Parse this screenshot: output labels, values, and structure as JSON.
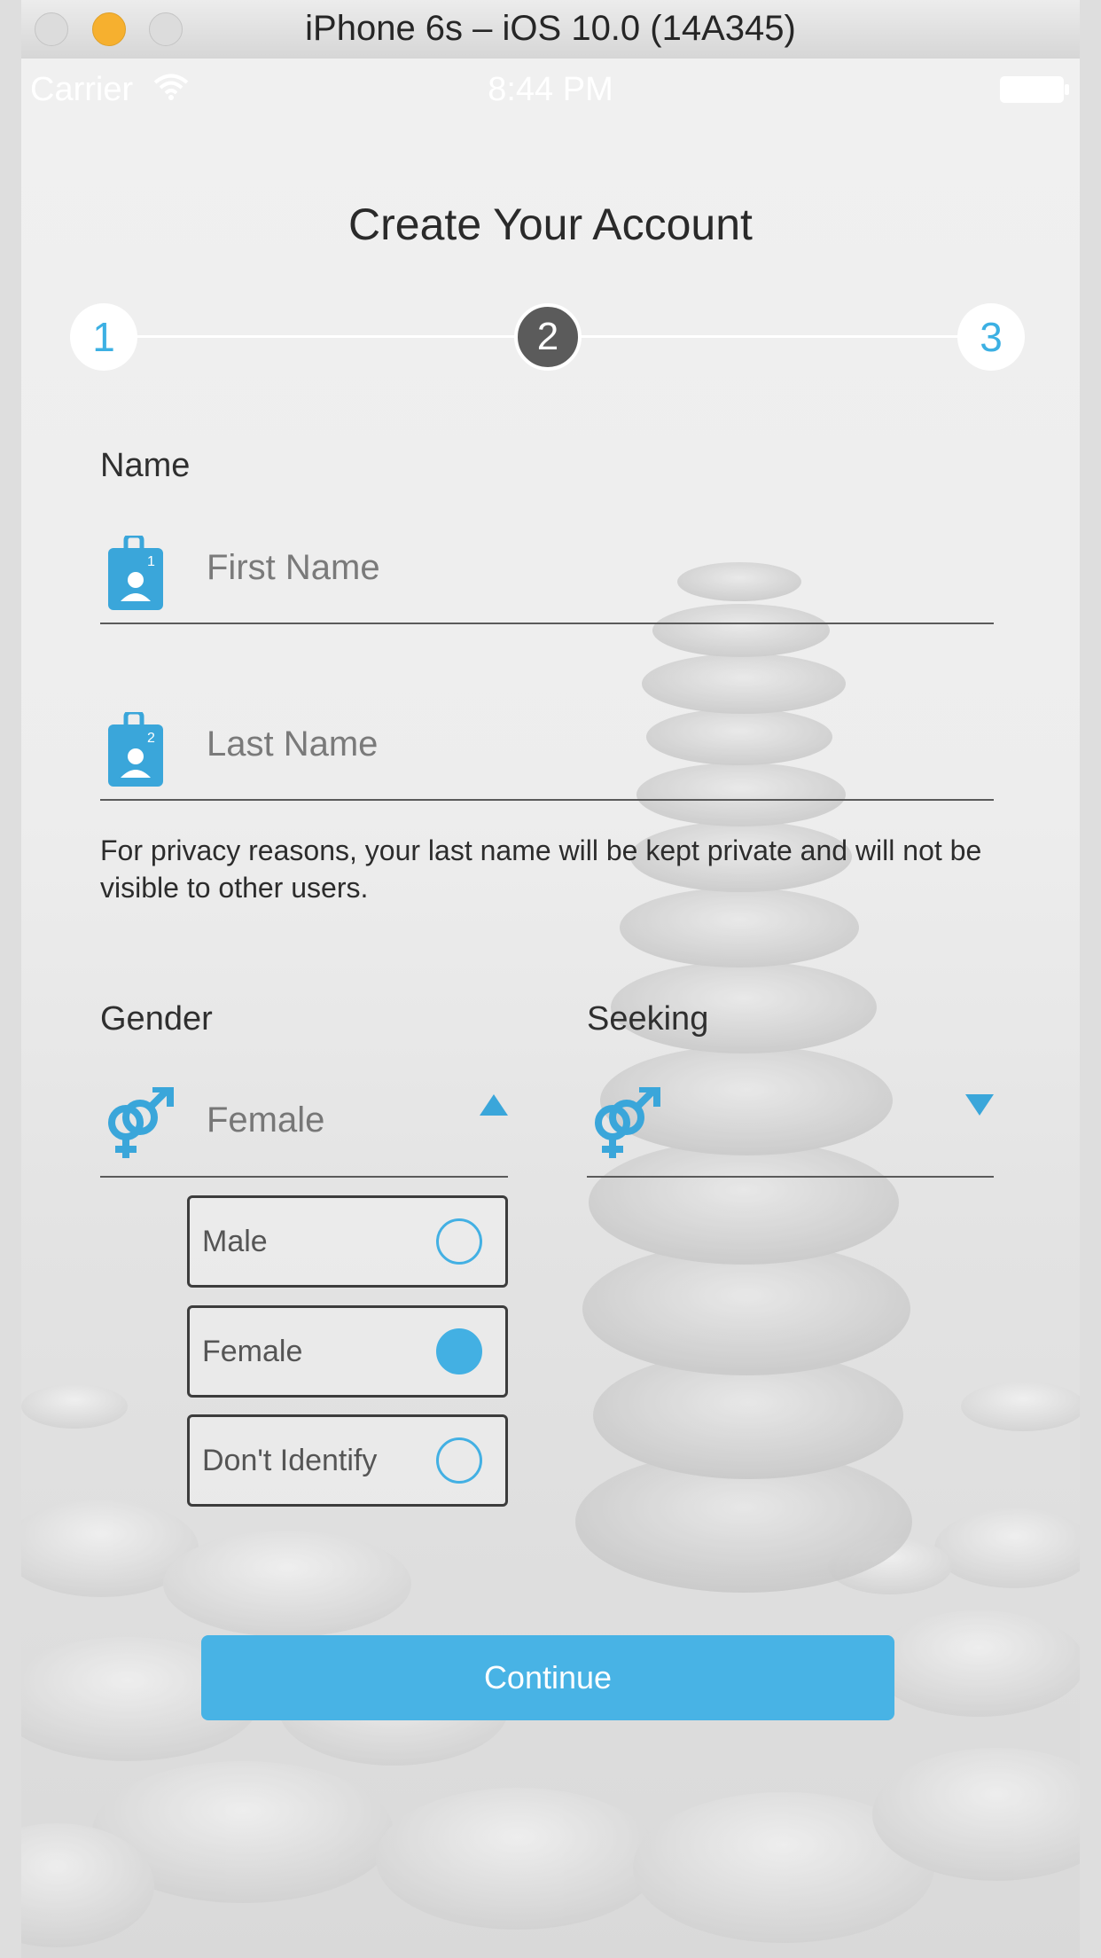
{
  "window": {
    "title": "iPhone 6s – iOS 10.0 (14A345)"
  },
  "status_bar": {
    "carrier": "Carrier",
    "time": "8:44 PM"
  },
  "page": {
    "title": "Create Your Account"
  },
  "stepper": {
    "steps": [
      "1",
      "2",
      "3"
    ],
    "current": 2
  },
  "name_section": {
    "label": "Name",
    "first_name_placeholder": "First Name",
    "last_name_placeholder": "Last Name",
    "privacy_note": "For privacy reasons, your last name will be kept private and will not be visible to other users."
  },
  "gender": {
    "label": "Gender",
    "selected": "Female",
    "options": [
      {
        "label": "Male",
        "selected": false
      },
      {
        "label": "Female",
        "selected": true
      },
      {
        "label": "Don't Identify",
        "selected": false
      }
    ]
  },
  "seeking": {
    "label": "Seeking",
    "selected": ""
  },
  "actions": {
    "continue_label": "Continue"
  },
  "colors": {
    "accent": "#48b3e5",
    "active_step": "#5b5b5b",
    "traffic_minimize": "#f6b02f"
  },
  "icons": [
    "wifi-icon",
    "battery-icon",
    "id-badge-icon",
    "gender-symbol-icon",
    "caret-up-icon",
    "caret-down-icon"
  ]
}
